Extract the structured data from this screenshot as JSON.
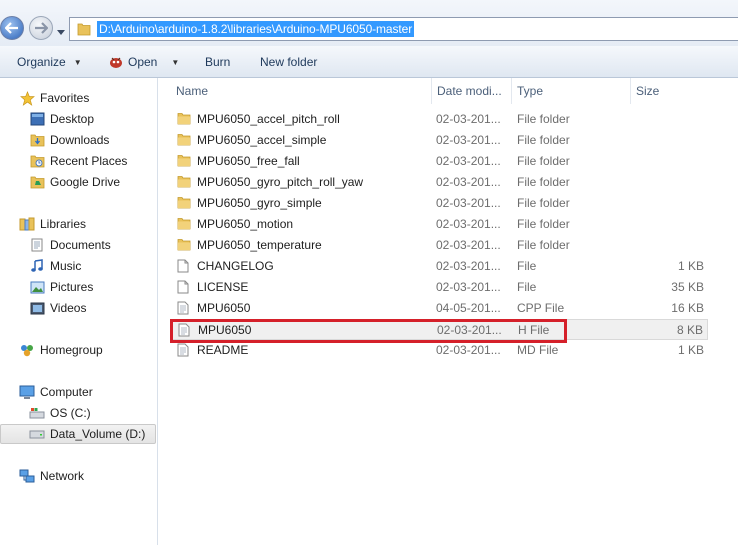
{
  "address": {
    "path": "D:\\Arduino\\arduino-1.8.2\\libraries\\Arduino-MPU6050-master"
  },
  "toolbar": {
    "organize": "Organize",
    "open": "Open",
    "burn": "Burn",
    "new_folder": "New folder"
  },
  "nav": {
    "favorites": "Favorites",
    "desktop": "Desktop",
    "downloads": "Downloads",
    "recent_places": "Recent Places",
    "google_drive": "Google Drive",
    "libraries": "Libraries",
    "documents": "Documents",
    "music": "Music",
    "pictures": "Pictures",
    "videos": "Videos",
    "homegroup": "Homegroup",
    "computer": "Computer",
    "os_c": "OS (C:)",
    "data_volume": "Data_Volume (D:)",
    "network": "Network"
  },
  "columns": {
    "name": "Name",
    "date": "Date modi...",
    "type": "Type",
    "size": "Size"
  },
  "files": [
    {
      "name": "MPU6050_accel_pitch_roll",
      "date": "02-03-201...",
      "type": "File folder",
      "size": "",
      "icon": "folder-icon"
    },
    {
      "name": "MPU6050_accel_simple",
      "date": "02-03-201...",
      "type": "File folder",
      "size": "",
      "icon": "folder-icon"
    },
    {
      "name": "MPU6050_free_fall",
      "date": "02-03-201...",
      "type": "File folder",
      "size": "",
      "icon": "folder-icon"
    },
    {
      "name": "MPU6050_gyro_pitch_roll_yaw",
      "date": "02-03-201...",
      "type": "File folder",
      "size": "",
      "icon": "folder-icon"
    },
    {
      "name": "MPU6050_gyro_simple",
      "date": "02-03-201...",
      "type": "File folder",
      "size": "",
      "icon": "folder-icon"
    },
    {
      "name": "MPU6050_motion",
      "date": "02-03-201...",
      "type": "File folder",
      "size": "",
      "icon": "folder-icon"
    },
    {
      "name": "MPU6050_temperature",
      "date": "02-03-201...",
      "type": "File folder",
      "size": "",
      "icon": "folder-icon"
    },
    {
      "name": "CHANGELOG",
      "date": "02-03-201...",
      "type": "File",
      "size": "1 KB",
      "icon": "file-icon"
    },
    {
      "name": "LICENSE",
      "date": "02-03-201...",
      "type": "File",
      "size": "35 KB",
      "icon": "file-icon"
    },
    {
      "name": "MPU6050",
      "date": "04-05-201...",
      "type": "CPP File",
      "size": "16 KB",
      "icon": "text-file-icon"
    },
    {
      "name": "MPU6050",
      "date": "02-03-201...",
      "type": "H File",
      "size": "8 KB",
      "icon": "text-file-icon"
    },
    {
      "name": "README",
      "date": "02-03-201...",
      "type": "MD File",
      "size": "1 KB",
      "icon": "text-file-icon"
    }
  ],
  "colors": {
    "highlight_box": "#d5202a",
    "address_selection": "#3399ff",
    "folder": "#e9c25a"
  }
}
